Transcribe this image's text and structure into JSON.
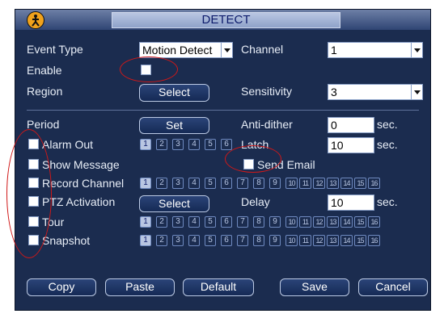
{
  "title": "DETECT",
  "labels": {
    "event_type": "Event Type",
    "channel": "Channel",
    "enable": "Enable",
    "region": "Region",
    "sensitivity": "Sensitivity",
    "period": "Period",
    "anti_dither": "Anti-dither",
    "alarm_out": "Alarm Out",
    "latch": "Latch",
    "show_message": "Show Message",
    "send_email": "Send Email",
    "record_channel": "Record Channel",
    "ptz_activation": "PTZ Activation",
    "delay": "Delay",
    "tour": "Tour",
    "snapshot": "Snapshot",
    "sec": "sec."
  },
  "fields": {
    "event_type": "Motion Detect",
    "channel": "1",
    "sensitivity": "3",
    "anti_dither": "0",
    "latch": "10",
    "delay": "10"
  },
  "buttons": {
    "region": "Select",
    "period": "Set",
    "ptz": "Select",
    "copy": "Copy",
    "paste": "Paste",
    "default": "Default",
    "save": "Save",
    "cancel": "Cancel"
  },
  "channel_numbers": [
    "1",
    "2",
    "3",
    "4",
    "5",
    "6",
    "7",
    "8",
    "9",
    "10",
    "11",
    "12",
    "13",
    "14",
    "15",
    "16"
  ],
  "alarm_out_numbers": [
    "1",
    "2",
    "3",
    "4",
    "5",
    "6"
  ],
  "colors": {
    "background": "#1b2c4f",
    "title_text": "#0d1b6b",
    "annotation": "#d01818"
  }
}
